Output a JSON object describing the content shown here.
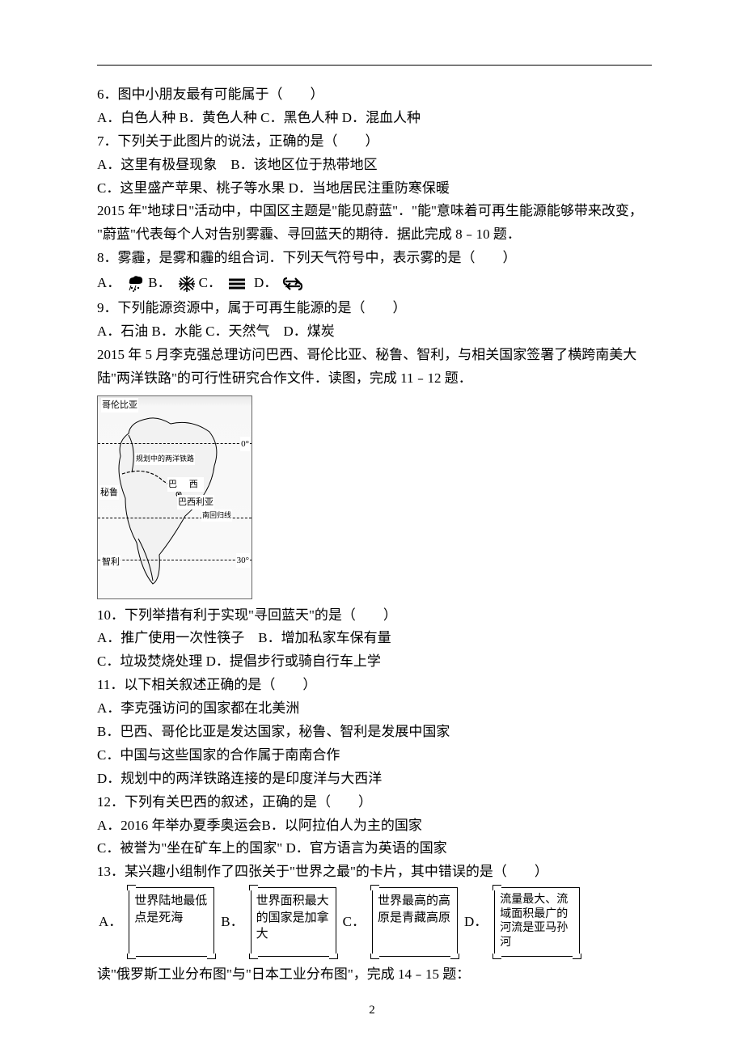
{
  "page_number": "2",
  "q6": {
    "stem": "6．图中小朋友最有可能属于（　　）",
    "opts": "A．白色人种 B．黄色人种 C．黑色人种 D．混血人种"
  },
  "q7": {
    "stem": "7．下列关于此图片的说法，正确的是（　　）",
    "a": "A．这里有极昼现象　B．该地区位于热带地区",
    "b": "C．这里盛产苹果、桃子等水果 D．当地居民注重防寒保暖"
  },
  "intro8": {
    "l1": "2015 年\"地球日\"活动中，中国区主题是\"能见蔚蓝\"．\"能\"意味着可再生能源能够带来改变，",
    "l2": "\"蔚蓝\"代表每个人对告别雾霾、寻回蓝天的期待．据此完成 8﹣10 题．"
  },
  "q8": {
    "stem": "8．雾霾，是雾和霾的组合词．下列天气符号中，表示雾的是（　　）"
  },
  "q8_labels": {
    "a": "A．",
    "b": "B．",
    "c": "C．",
    "d": "D．"
  },
  "q9": {
    "stem": "9．下列能源资源中，属于可再生能源的是（　　）",
    "opts": "A．石油 B．水能 C．天然气　D．煤炭"
  },
  "intro11": {
    "l1": "2015 年 5 月李克强总理访问巴西、哥伦比亚、秘鲁、智利，与相关国家签署了横跨南美大",
    "l2": "陆\"两洋铁路\"的可行性研究合作文件．读图，完成 11﹣12 题．"
  },
  "map_labels": {
    "colombia": "哥伦比亚",
    "peru": "秘鲁",
    "chile": "智利",
    "brazil": "巴 西",
    "brasilia": "巴西利亚",
    "rail": "规划中的两洋铁路",
    "eq": "0°",
    "tropic_s": "南回归线",
    "lat30": "30°"
  },
  "q10": {
    "stem": "10．下列举措有利于实现\"寻回蓝天\"的是（　　）",
    "a": "A．推广使用一次性筷子　B．增加私家车保有量",
    "b": "C．垃圾焚烧处理 D．提倡步行或骑自行车上学"
  },
  "q11": {
    "stem": "11．以下相关叙述正确的是（　　）",
    "a": "A．李克强访问的国家都在北美洲",
    "b": "B．巴西、哥伦比亚是发达国家，秘鲁、智利是发展中国家",
    "c": "C．中国与这些国家的合作属于南南合作",
    "d": "D．规划中的两洋铁路连接的是印度洋与大西洋"
  },
  "q12": {
    "stem": "12．下列有关巴西的叙述，正确的是（　　）",
    "a": "A．2016 年举办夏季奥运会B．以阿拉伯人为主的国家",
    "b": "C．被誉为\"坐在矿车上的国家\" D．官方语言为英语的国家"
  },
  "q13": {
    "stem": "13．某兴趣小组制作了四张关于\"世界之最\"的卡片，其中错误的是（　　）"
  },
  "cards": {
    "a_label": "A．",
    "a_text": "世界陆地最低点是死海",
    "b_label": "B．",
    "b_text": "世界面积最大的国家是加拿大",
    "c_label": "C．",
    "c_text": "世界最高的高原是青藏高原",
    "d_label": "D．",
    "d_text": "流量最大、流域面积最广的河流是亚马孙河"
  },
  "intro14": "读\"俄罗斯工业分布图\"与\"日本工业分布图\"，完成 14﹣15 题："
}
